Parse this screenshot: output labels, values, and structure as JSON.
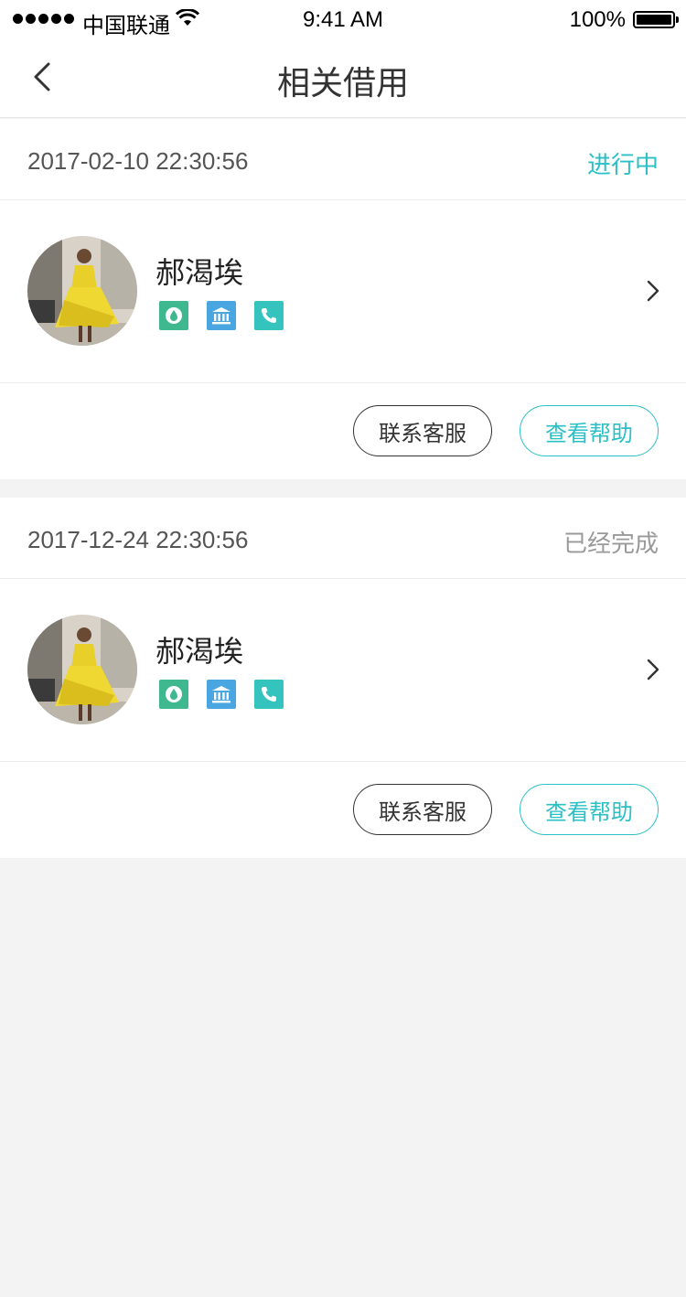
{
  "status_bar": {
    "carrier": "中国联通",
    "time": "9:41 AM",
    "battery": "100%"
  },
  "nav": {
    "title": "相关借用"
  },
  "records": [
    {
      "time": "2017-02-10 22:30:56",
      "status": "进行中",
      "name": "郝渴埃",
      "icons": [
        "drop-icon",
        "bank-icon",
        "phone-icon"
      ],
      "contact_label": "联系客服",
      "help_label": "查看帮助"
    },
    {
      "time": "2017-12-24 22:30:56",
      "status": "已经完成",
      "name": "郝渴埃",
      "icons": [
        "drop-icon",
        "bank-icon",
        "phone-icon"
      ],
      "contact_label": "联系客服",
      "help_label": "查看帮助"
    }
  ],
  "colors": {
    "accent": "#2bc0c6",
    "status_done": "#999999",
    "drop_icon_bg": "#3fb88f",
    "bank_icon_bg": "#4aa6e0",
    "phone_icon_bg": "#35c3be",
    "background": "#f3f3f3"
  }
}
